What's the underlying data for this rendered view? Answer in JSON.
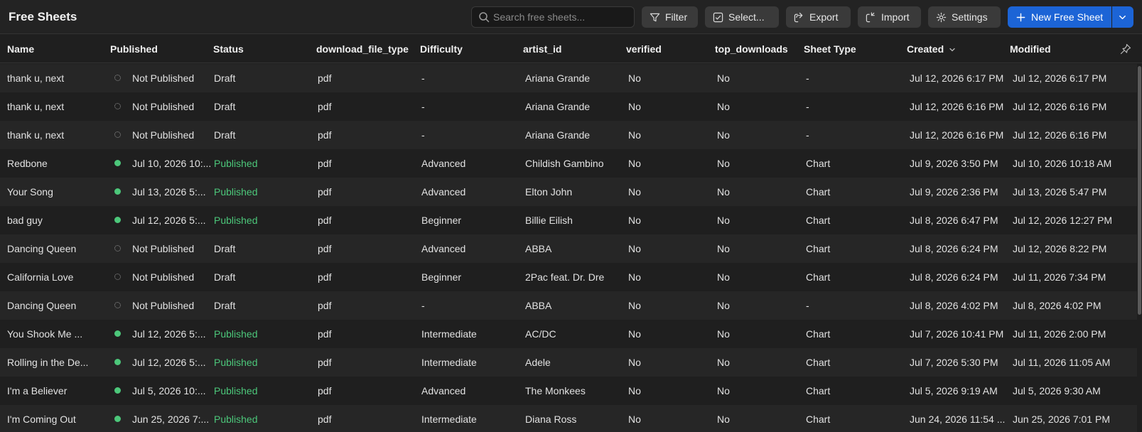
{
  "app": {
    "title": "Free Sheets"
  },
  "search": {
    "placeholder": "Search free sheets..."
  },
  "toolbar": {
    "filter_label": "Filter",
    "select_label": "Select...",
    "export_label": "Export",
    "import_label": "Import",
    "settings_label": "Settings",
    "new_label": "New Free Sheet"
  },
  "colors": {
    "accent": "#1c64d6",
    "published": "#4cc77a",
    "background": "#1f1f1f"
  },
  "columns": [
    "Name",
    "Published",
    "Status",
    "download_file_type",
    "Difficulty",
    "artist_id",
    "verified",
    "top_downloads",
    "Sheet Type",
    "Created",
    "Modified"
  ],
  "rows": [
    {
      "name": "thank u, next",
      "published": "Not Published",
      "is_published": false,
      "status": "Draft",
      "file_type": "pdf",
      "difficulty": "-",
      "artist": "Ariana Grande",
      "verified": "No",
      "top_downloads": "No",
      "sheet_type": "-",
      "created": "Jul 12, 2026 6:17 PM",
      "modified": "Jul 12, 2026 6:17 PM"
    },
    {
      "name": "thank u, next",
      "published": "Not Published",
      "is_published": false,
      "status": "Draft",
      "file_type": "pdf",
      "difficulty": "-",
      "artist": "Ariana Grande",
      "verified": "No",
      "top_downloads": "No",
      "sheet_type": "-",
      "created": "Jul 12, 2026 6:16 PM",
      "modified": "Jul 12, 2026 6:16 PM"
    },
    {
      "name": "thank u, next",
      "published": "Not Published",
      "is_published": false,
      "status": "Draft",
      "file_type": "pdf",
      "difficulty": "-",
      "artist": "Ariana Grande",
      "verified": "No",
      "top_downloads": "No",
      "sheet_type": "-",
      "created": "Jul 12, 2026 6:16 PM",
      "modified": "Jul 12, 2026 6:16 PM"
    },
    {
      "name": "Redbone",
      "published": "Jul 10, 2026 10:...",
      "is_published": true,
      "status": "Published",
      "file_type": "pdf",
      "difficulty": "Advanced",
      "artist": "Childish Gambino",
      "verified": "No",
      "top_downloads": "No",
      "sheet_type": "Chart",
      "created": "Jul 9, 2026 3:50 PM",
      "modified": "Jul 10, 2026 10:18 AM"
    },
    {
      "name": "Your Song",
      "published": "Jul 13, 2026 5:...",
      "is_published": true,
      "status": "Published",
      "file_type": "pdf",
      "difficulty": "Advanced",
      "artist": "Elton John",
      "verified": "No",
      "top_downloads": "No",
      "sheet_type": "Chart",
      "created": "Jul 9, 2026 2:36 PM",
      "modified": "Jul 13, 2026 5:47 PM"
    },
    {
      "name": "bad guy",
      "published": "Jul 12, 2026 5:...",
      "is_published": true,
      "status": "Published",
      "file_type": "pdf",
      "difficulty": "Beginner",
      "artist": "Billie Eilish",
      "verified": "No",
      "top_downloads": "No",
      "sheet_type": "Chart",
      "created": "Jul 8, 2026 6:47 PM",
      "modified": "Jul 12, 2026 12:27 PM"
    },
    {
      "name": "Dancing Queen",
      "published": "Not Published",
      "is_published": false,
      "status": "Draft",
      "file_type": "pdf",
      "difficulty": "Advanced",
      "artist": "ABBA",
      "verified": "No",
      "top_downloads": "No",
      "sheet_type": "Chart",
      "created": "Jul 8, 2026 6:24 PM",
      "modified": "Jul 12, 2026 8:22 PM"
    },
    {
      "name": "California Love",
      "published": "Not Published",
      "is_published": false,
      "status": "Draft",
      "file_type": "pdf",
      "difficulty": "Beginner",
      "artist": "2Pac feat. Dr. Dre",
      "verified": "No",
      "top_downloads": "No",
      "sheet_type": "Chart",
      "created": "Jul 8, 2026 6:24 PM",
      "modified": "Jul 11, 2026 7:34 PM"
    },
    {
      "name": "Dancing Queen",
      "published": "Not Published",
      "is_published": false,
      "status": "Draft",
      "file_type": "pdf",
      "difficulty": "-",
      "artist": "ABBA",
      "verified": "No",
      "top_downloads": "No",
      "sheet_type": "-",
      "created": "Jul 8, 2026 4:02 PM",
      "modified": "Jul 8, 2026 4:02 PM"
    },
    {
      "name": "You Shook Me ...",
      "published": "Jul 12, 2026 5:...",
      "is_published": true,
      "status": "Published",
      "file_type": "pdf",
      "difficulty": "Intermediate",
      "artist": "AC/DC",
      "verified": "No",
      "top_downloads": "No",
      "sheet_type": "Chart",
      "created": "Jul 7, 2026 10:41 PM",
      "modified": "Jul 11, 2026 2:00 PM"
    },
    {
      "name": "Rolling in the De...",
      "published": "Jul 12, 2026 5:...",
      "is_published": true,
      "status": "Published",
      "file_type": "pdf",
      "difficulty": "Intermediate",
      "artist": "Adele",
      "verified": "No",
      "top_downloads": "No",
      "sheet_type": "Chart",
      "created": "Jul 7, 2026 5:30 PM",
      "modified": "Jul 11, 2026 11:05 AM"
    },
    {
      "name": "I'm a Believer",
      "published": "Jul 5, 2026 10:...",
      "is_published": true,
      "status": "Published",
      "file_type": "pdf",
      "difficulty": "Advanced",
      "artist": "The Monkees",
      "verified": "No",
      "top_downloads": "No",
      "sheet_type": "Chart",
      "created": "Jul 5, 2026 9:19 AM",
      "modified": "Jul 5, 2026 9:30 AM"
    },
    {
      "name": "I'm Coming Out",
      "published": "Jun 25, 2026 7:...",
      "is_published": true,
      "status": "Published",
      "file_type": "pdf",
      "difficulty": "Intermediate",
      "artist": "Diana Ross",
      "verified": "No",
      "top_downloads": "No",
      "sheet_type": "Chart",
      "created": "Jun 24, 2026 11:54 ...",
      "modified": "Jun 25, 2026 7:01 PM"
    }
  ]
}
